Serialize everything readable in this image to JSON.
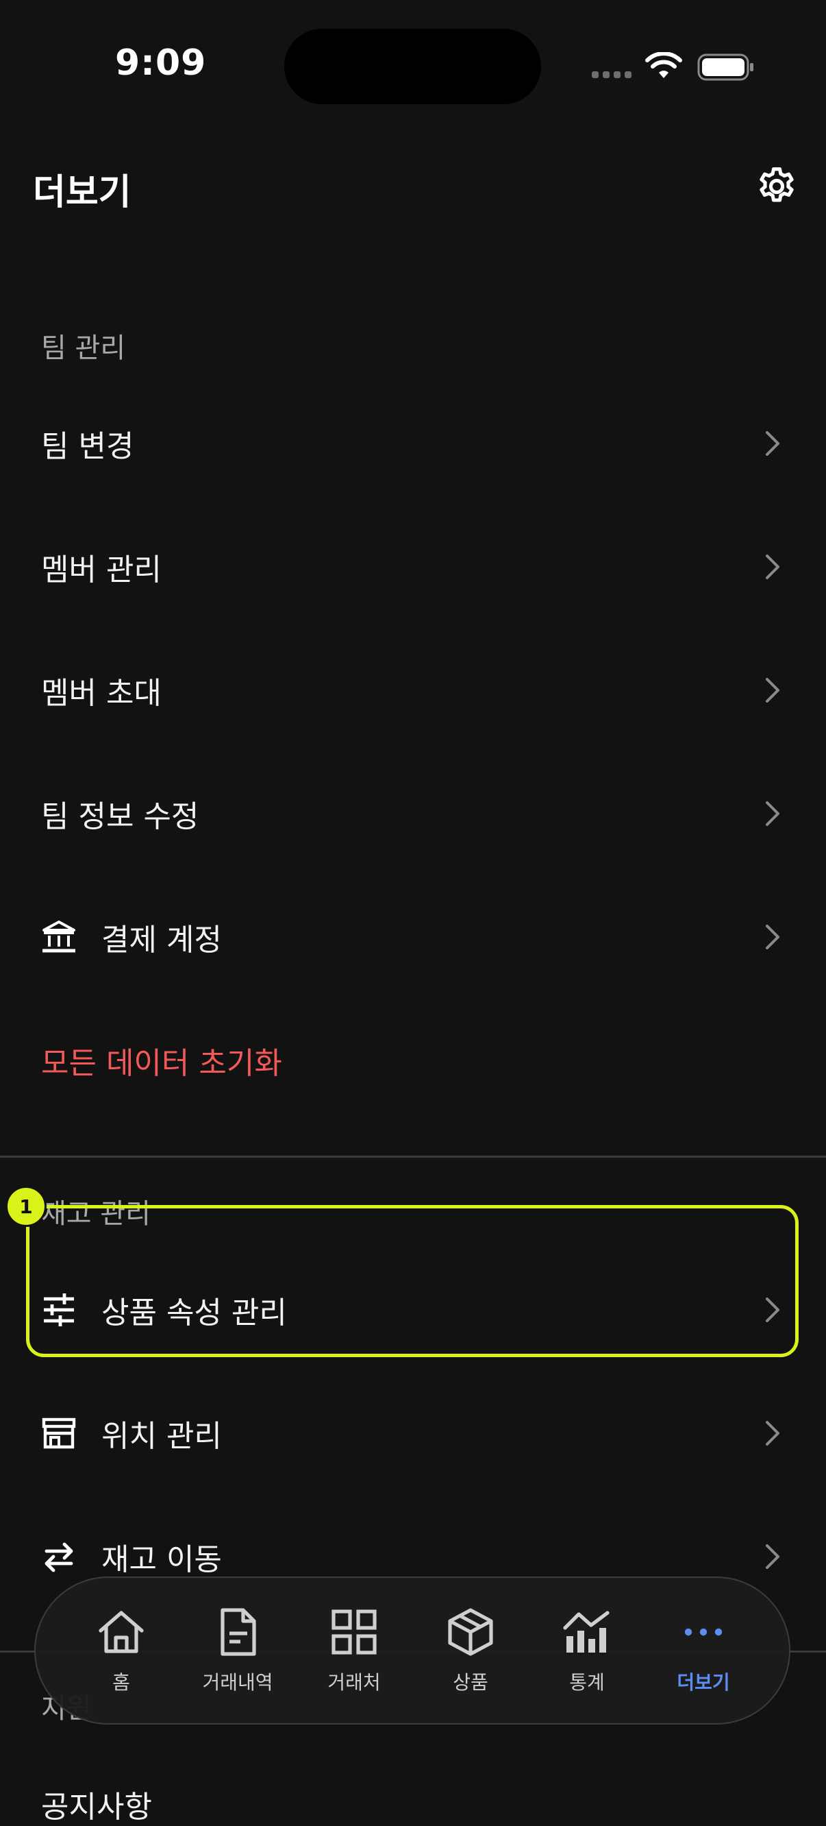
{
  "status_bar": {
    "time": "9:09"
  },
  "header": {
    "title": "더보기",
    "settings_icon": "gear-icon"
  },
  "sections": [
    {
      "title": "팀 관리",
      "items": [
        {
          "label": "팀 변경"
        },
        {
          "label": "멤버 관리"
        },
        {
          "label": "멤버 초대"
        },
        {
          "label": "팀 정보 수정"
        },
        {
          "label": "결제 계정",
          "icon": "bank-icon"
        },
        {
          "label": "모든 데이터 초기화",
          "danger": true
        }
      ]
    },
    {
      "title": "재고 관리",
      "items": [
        {
          "label": "상품 속성 관리",
          "icon": "sliders-icon"
        },
        {
          "label": "위치 관리",
          "icon": "store-icon"
        },
        {
          "label": "재고 이동",
          "icon": "transfer-icon"
        }
      ]
    },
    {
      "title": "지원",
      "items": [
        {
          "label": "공지사항"
        }
      ]
    }
  ],
  "highlight": {
    "badge": "1"
  },
  "tab_bar": {
    "tabs": [
      {
        "label": "홈",
        "icon": "home-icon"
      },
      {
        "label": "거래내역",
        "icon": "document-icon"
      },
      {
        "label": "거래처",
        "icon": "grid-icon"
      },
      {
        "label": "상품",
        "icon": "box-icon"
      },
      {
        "label": "통계",
        "icon": "chart-icon"
      },
      {
        "label": "더보기",
        "icon": "more-icon",
        "active": true
      }
    ]
  },
  "colors": {
    "background": "#121212",
    "danger": "#f25a5a",
    "accent": "#5b8ef0",
    "highlight": "#d8f21a"
  }
}
